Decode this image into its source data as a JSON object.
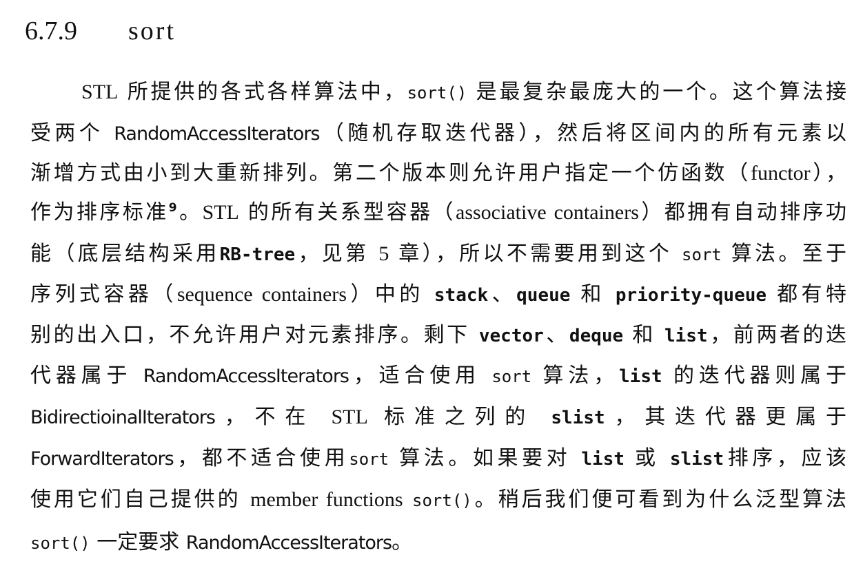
{
  "section": {
    "number": "6.7.9",
    "title": "sort"
  },
  "paragraph": {
    "l1": [
      "STL",
      "所提供的各式各样算法中，",
      "sort()",
      "是最复杂最庞大的一个。这个算法接"
    ],
    "l2": [
      "受两个",
      "RandomAccessIterators",
      "（随机存取迭代器），然后将区间内的所有元素以"
    ],
    "l3": [
      "渐增方式由小到大重新排列。第二个版本则允许用户指定一个仿函数（",
      "functor",
      "），"
    ],
    "l4": [
      "作为排序标准",
      "9",
      "。",
      "STL",
      "的所有关系型容器（",
      "associative containers",
      "）都拥有自动排序功"
    ],
    "l5": [
      "能（底层结构采用",
      "RB-tree",
      "，见第",
      "5",
      "章），所以不需要用到这个",
      "sort",
      "算法。至于"
    ],
    "l6": [
      "序列式容器（",
      "sequence containers",
      "）中的",
      "stack",
      "、",
      "queue",
      "和",
      "priority-queue",
      "都有特"
    ],
    "l7": [
      "别的出入口，不允许用户对元素排序。剩下",
      "vector",
      "、",
      "deque",
      "和",
      "list",
      "，前两者的迭"
    ],
    "l8": [
      "代器属于",
      "RandomAccessIterators",
      "，适合使用",
      "sort",
      "算法，",
      "list",
      "的迭代器则属于"
    ],
    "l9": [
      "BidirectioinalIterators",
      "，不在",
      "STL",
      "标准之列的",
      "slist",
      "，其迭代器更属于"
    ],
    "l10": [
      "ForwardIterators",
      "，都不适合使用",
      "sort",
      "算法。如果要对",
      "list",
      "或",
      "slist",
      "排序，应该"
    ],
    "l11": [
      "使用它们自己提供的",
      "member functions",
      "sort()",
      "。稍后我们便可看到为什么泛型算法"
    ],
    "l12": [
      "sort()",
      "一定要求",
      "RandomAccessIterators",
      "。"
    ]
  }
}
